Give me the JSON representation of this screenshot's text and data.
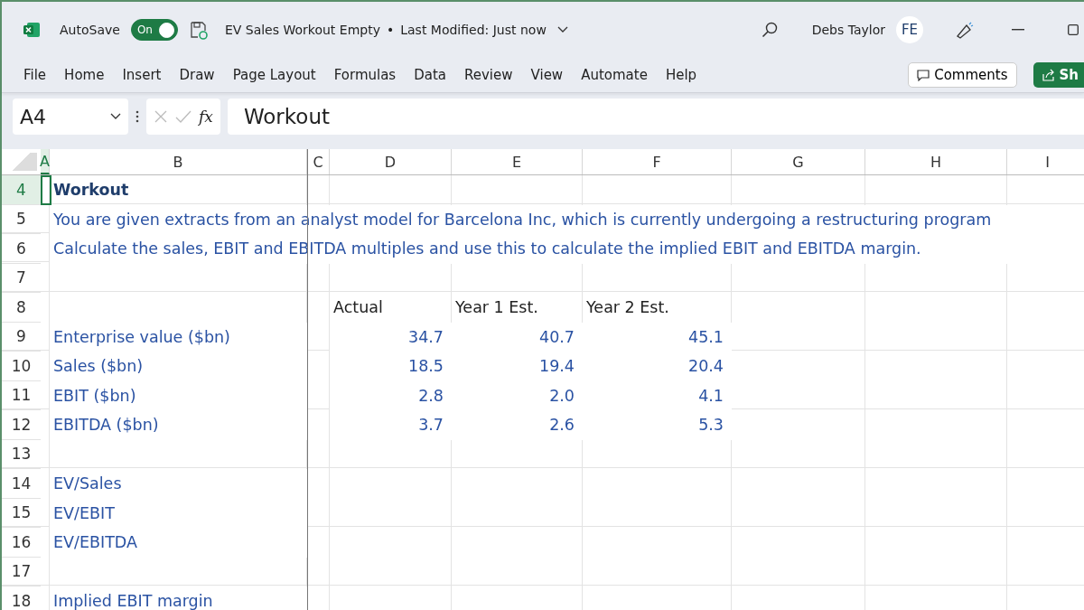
{
  "title_bar": {
    "autosave_label": "AutoSave",
    "autosave": {
      "on": true,
      "label": "On"
    },
    "document_title": "EV Sales Workout Empty",
    "separator": "•",
    "modified": "Last Modified: Just now",
    "user_name": "Debs Taylor",
    "avatar_initials": "FE"
  },
  "ribbon_tabs": [
    {
      "label": "File"
    },
    {
      "label": "Home"
    },
    {
      "label": "Insert"
    },
    {
      "label": "Draw"
    },
    {
      "label": "Page Layout"
    },
    {
      "label": "Formulas"
    },
    {
      "label": "Data"
    },
    {
      "label": "Review"
    },
    {
      "label": "View"
    },
    {
      "label": "Automate"
    },
    {
      "label": "Help"
    }
  ],
  "ribbon_buttons": {
    "comments": "Comments",
    "share": "Sh"
  },
  "formula_bar": {
    "name_box": "A4",
    "fx": "fx",
    "formula": "Workout"
  },
  "sheet": {
    "columns": [
      {
        "label": "A",
        "selected": true
      },
      {
        "label": "B",
        "selected": false
      },
      {
        "label": "C",
        "selected": false
      },
      {
        "label": "D",
        "selected": false
      },
      {
        "label": "E",
        "selected": false
      },
      {
        "label": "F",
        "selected": false
      },
      {
        "label": "G",
        "selected": false
      },
      {
        "label": "H",
        "selected": false
      },
      {
        "label": "I",
        "selected": false
      }
    ],
    "rows": [
      {
        "number": "4",
        "selected": true,
        "kind": "title",
        "cells": [
          "",
          "Workout"
        ]
      },
      {
        "number": "5",
        "selected": false,
        "kind": "text",
        "cells": [
          "",
          "You are given extracts from an analyst model for Barcelona Inc, which is currently undergoing a restructuring program"
        ]
      },
      {
        "number": "6",
        "selected": false,
        "kind": "text",
        "cells": [
          "",
          "Calculate the sales, EBIT and EBITDA multiples and use this to calculate the implied EBIT and EBITDA margin."
        ]
      },
      {
        "number": "7",
        "selected": false,
        "kind": "blank",
        "cells": []
      },
      {
        "number": "8",
        "selected": false,
        "kind": "header",
        "cells": [
          "",
          "",
          "",
          "Actual",
          "Year 1 Est.",
          "Year 2 Est."
        ]
      },
      {
        "number": "9",
        "selected": false,
        "kind": "data",
        "cells": [
          "",
          "Enterprise value ($bn)",
          "",
          "34.7",
          "40.7",
          "45.1"
        ]
      },
      {
        "number": "10",
        "selected": false,
        "kind": "data",
        "cells": [
          "",
          "Sales ($bn)",
          "",
          "18.5",
          "19.4",
          "20.4"
        ]
      },
      {
        "number": "11",
        "selected": false,
        "kind": "data",
        "cells": [
          "",
          "EBIT ($bn)",
          "",
          "2.8",
          "2.0",
          "4.1"
        ]
      },
      {
        "number": "12",
        "selected": false,
        "kind": "data",
        "cells": [
          "",
          "EBITDA ($bn)",
          "",
          "3.7",
          "2.6",
          "5.3"
        ]
      },
      {
        "number": "13",
        "selected": false,
        "kind": "blank",
        "cells": []
      },
      {
        "number": "14",
        "selected": false,
        "kind": "data",
        "cells": [
          "",
          "EV/Sales"
        ]
      },
      {
        "number": "15",
        "selected": false,
        "kind": "data",
        "cells": [
          "",
          "EV/EBIT"
        ]
      },
      {
        "number": "16",
        "selected": false,
        "kind": "data",
        "cells": [
          "",
          "EV/EBITDA"
        ]
      },
      {
        "number": "17",
        "selected": false,
        "kind": "blank",
        "cells": []
      },
      {
        "number": "18",
        "selected": false,
        "kind": "data",
        "cells": [
          "",
          "Implied EBIT margin"
        ]
      }
    ]
  }
}
